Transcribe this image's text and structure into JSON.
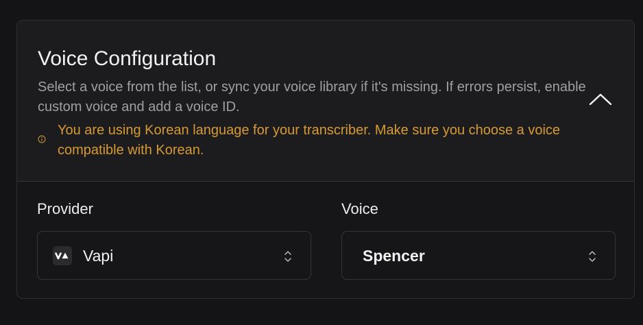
{
  "voice_config": {
    "title": "Voice Configuration",
    "description": "Select a voice from the list, or sync your voice library if it's missing. If errors persist, enable custom voice and add a voice ID.",
    "warning": "You are using Korean language for your transcriber. Make sure you choose a voice compatible with Korean.",
    "collapse_icon": "chevron-up-icon",
    "warning_icon": "info-circle-icon",
    "warning_color": "#d69a35"
  },
  "provider": {
    "label": "Provider",
    "value": "Vapi",
    "logo_icon": "vapi-logo-icon",
    "chevron_icon": "chevron-up-down-icon"
  },
  "voice": {
    "label": "Voice",
    "value": "Spencer",
    "chevron_icon": "chevron-up-down-icon"
  }
}
